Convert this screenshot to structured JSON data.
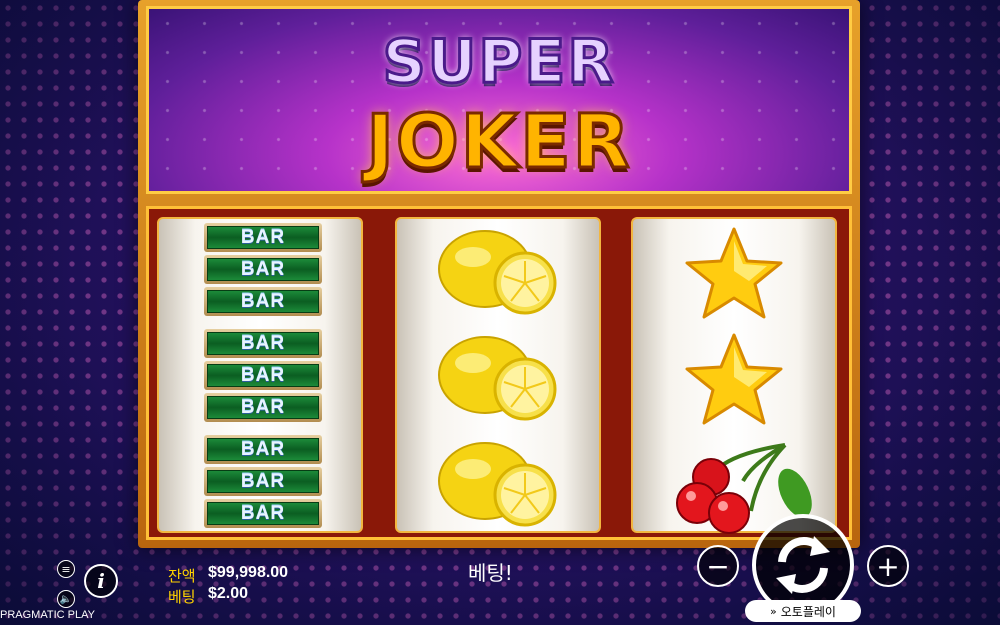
{
  "game": {
    "logo_line1": "SUPER",
    "logo_line2": "JOKER"
  },
  "reels": [
    {
      "symbols": [
        "BAR",
        "BAR",
        "BAR",
        "BAR",
        "BAR",
        "BAR",
        "BAR",
        "BAR",
        "BAR"
      ]
    },
    {
      "symbols": [
        "lemon-icon",
        "lemon-icon",
        "lemon-icon"
      ]
    },
    {
      "symbols": [
        "star-icon",
        "star-icon",
        "cherry-icon"
      ]
    }
  ],
  "hud": {
    "balance_label": "잔액",
    "balance_value": "$99,998.00",
    "bet_label": "베팅",
    "bet_value": "$2.00",
    "message": "베팅!",
    "autoplay_label": "오토플레이",
    "provider": "PRAGMATIC PLAY",
    "minus_symbol": "−",
    "plus_symbol": "+",
    "info_symbol": "i"
  },
  "colors": {
    "accent_gold": "#ffc037",
    "bar_green": "#0b5e22",
    "balance_yellow": "#ffd200"
  }
}
